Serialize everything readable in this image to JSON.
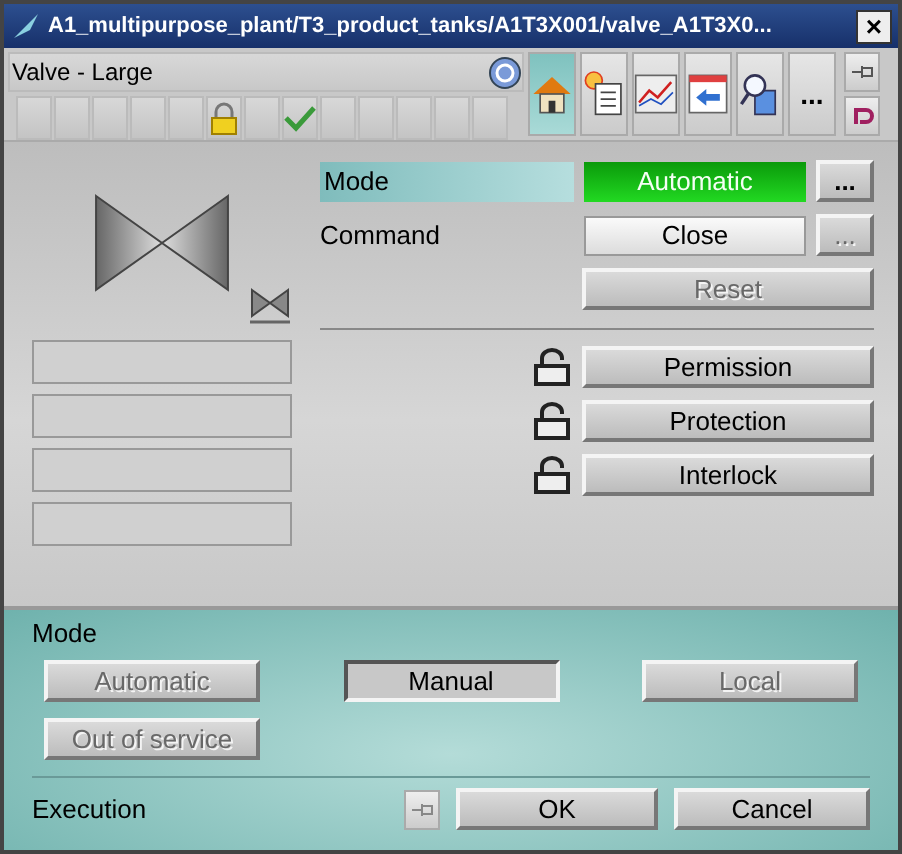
{
  "window": {
    "title": "A1_multipurpose_plant/T3_product_tanks/A1T3X001/valve_A1T3X0...",
    "close": "×"
  },
  "header": {
    "label": "Valve - Large",
    "status_cells": [
      {
        "kind": "empty"
      },
      {
        "kind": "empty"
      },
      {
        "kind": "empty"
      },
      {
        "kind": "empty"
      },
      {
        "kind": "empty"
      },
      {
        "kind": "lock"
      },
      {
        "kind": "empty"
      },
      {
        "kind": "check"
      },
      {
        "kind": "empty"
      },
      {
        "kind": "empty"
      },
      {
        "kind": "empty"
      },
      {
        "kind": "empty"
      },
      {
        "kind": "empty"
      }
    ],
    "views": [
      {
        "kind": "home",
        "selected": true
      },
      {
        "kind": "messages",
        "selected": false
      },
      {
        "kind": "trend",
        "selected": false
      },
      {
        "kind": "faceplate",
        "selected": false
      },
      {
        "kind": "search",
        "selected": false
      },
      {
        "kind": "more",
        "label": "...",
        "selected": false
      }
    ]
  },
  "mode": {
    "label": "Mode",
    "value": "Automatic",
    "more": "..."
  },
  "command": {
    "label": "Command",
    "value": "Close",
    "more": "...",
    "more_disabled": true
  },
  "reset": {
    "label": "Reset",
    "disabled": true
  },
  "interlocks": [
    {
      "label": "Permission",
      "locked": false
    },
    {
      "label": "Protection",
      "locked": false
    },
    {
      "label": "Interlock",
      "locked": false
    }
  ],
  "mode_panel": {
    "title": "Mode",
    "options": [
      {
        "label": "Automatic",
        "selected": false,
        "disabled": true
      },
      {
        "label": "Manual",
        "selected": true,
        "disabled": false
      },
      {
        "label": "Local",
        "selected": false,
        "disabled": true
      },
      {
        "label": "Out of service",
        "selected": false,
        "disabled": true
      }
    ]
  },
  "execution": {
    "label": "Execution",
    "ok": "OK",
    "cancel": "Cancel"
  }
}
